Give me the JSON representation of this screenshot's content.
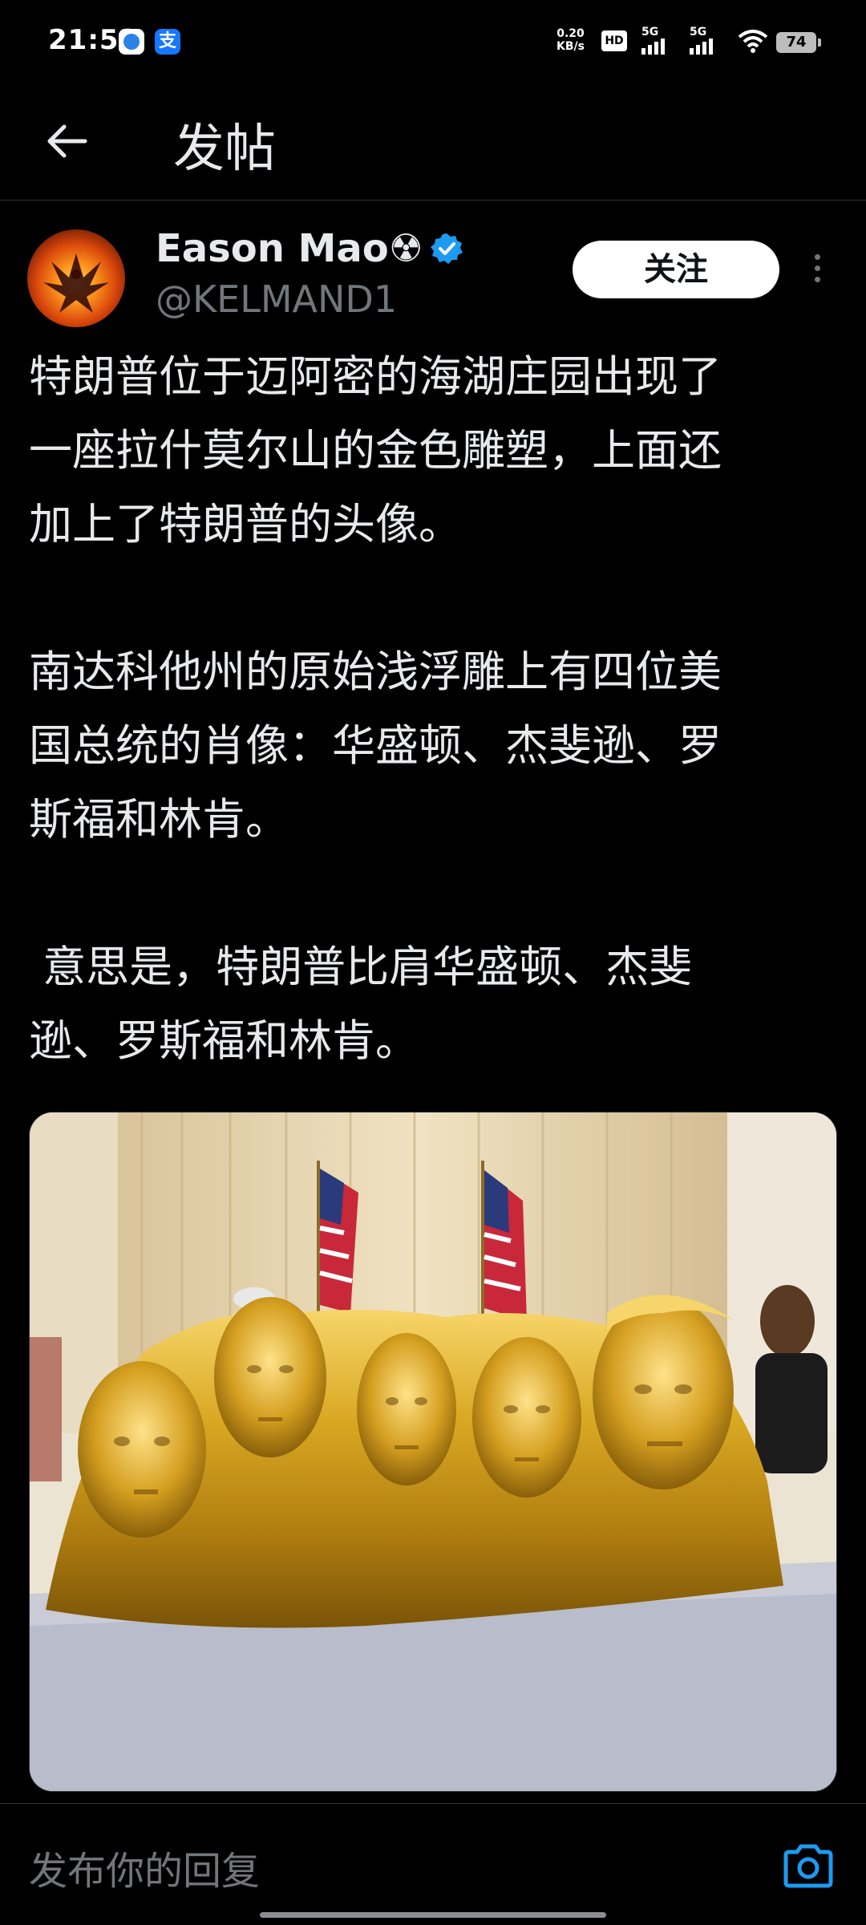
{
  "status_bar": {
    "time": "21:52",
    "app_icon_1": "alipay-qr-icon",
    "app_icon_2_text": "支",
    "net_speed_value": "0.20",
    "net_speed_unit": "KB/s",
    "hd_label": "HD",
    "signal_1_label": "5G",
    "signal_2_label": "5G",
    "battery": "74"
  },
  "header": {
    "title": "发帖",
    "back_icon": "arrow-left-icon"
  },
  "post": {
    "author_name": "Eason Mao☢",
    "verified_icon": "verified-badge-icon",
    "handle": "@KELMAND1",
    "follow_label": "关注",
    "more_icon": "more-vertical-icon",
    "paragraph_1_line_1": "特朗普位于迈阿密的海湖庄园出现了",
    "paragraph_1_line_2": "一座拉什莫尔山的金色雕塑，上面还",
    "paragraph_1_line_3": "加上了特朗普的头像。",
    "paragraph_2_line_1": "南达科他州的原始浅浮雕上有四位美",
    "paragraph_2_line_2": "国总统的肖像：华盛顿、杰斐逊、罗",
    "paragraph_2_line_3": "斯福和林肯。",
    "paragraph_3_line_1": " 意思是，特朗普比肩华盛顿、杰斐",
    "paragraph_3_line_2": "逊、罗斯福和林肯。"
  },
  "reply": {
    "placeholder": "发布你的回复",
    "camera_icon": "camera-icon"
  },
  "colors": {
    "background": "#000000",
    "text_primary": "#e7e9ea",
    "text_secondary": "#71767b",
    "accent": "#1d9bf0",
    "follow_bg": "#ffffff"
  }
}
